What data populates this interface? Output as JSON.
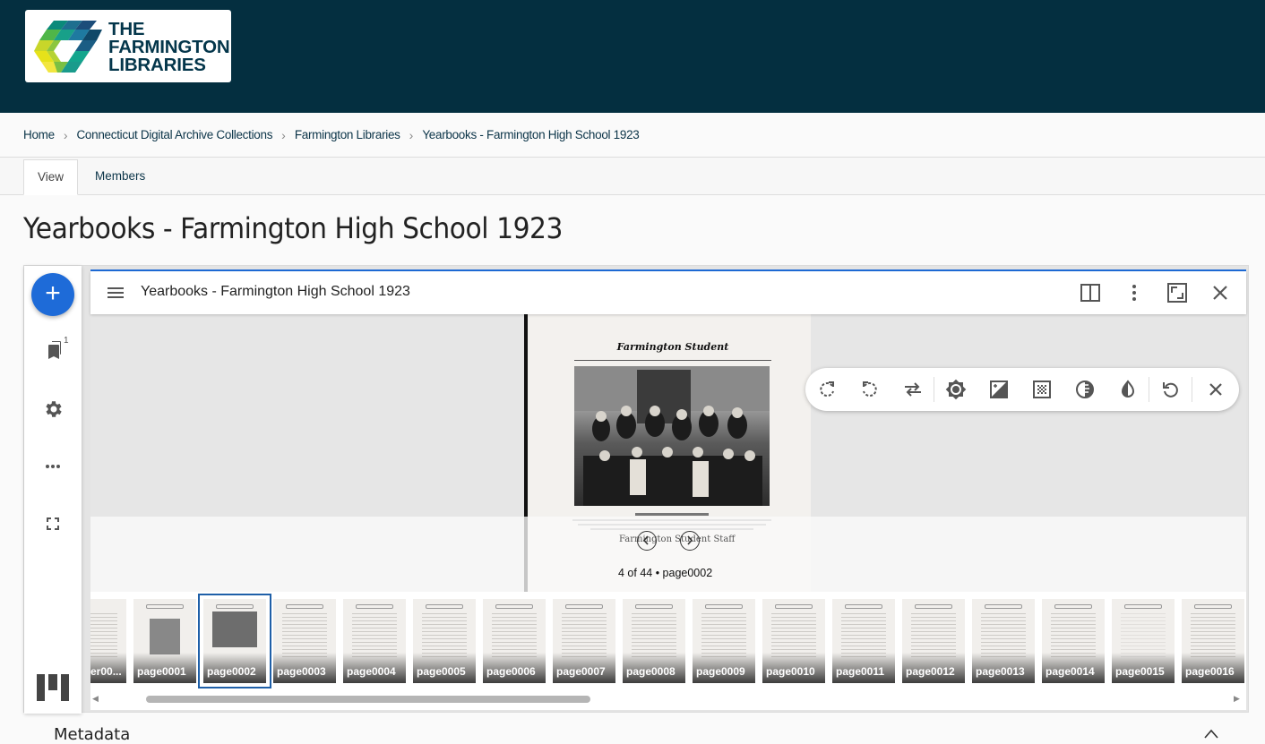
{
  "header": {
    "logo_lines": [
      "THE",
      "FARMINGTON",
      "LIBRARIES"
    ],
    "brand_color": "#042f40"
  },
  "breadcrumb": {
    "items": [
      "Home",
      "Connecticut Digital Archive Collections",
      "Farmington Libraries",
      "Yearbooks - Farmington High School 1923"
    ],
    "separator": "›"
  },
  "tabs": [
    {
      "label": "View",
      "active": true
    },
    {
      "label": "Members",
      "active": false
    }
  ],
  "page_title": "Yearbooks - Farmington High School 1923",
  "viewer": {
    "accent_color": "#1e6bd8",
    "window_title": "Yearbooks - Farmington High School 1923",
    "bookmark_count": "1",
    "rail_icons": [
      "add-icon",
      "bookmark-icon",
      "gear-icon",
      "more-horiz-icon",
      "fullscreen-icon",
      "mirador-logo-icon"
    ],
    "header_icons": [
      "book-view-icon",
      "more-vert-icon",
      "maximize-icon",
      "close-icon"
    ],
    "image_tools": [
      "rotate-right-icon",
      "rotate-left-icon",
      "flip-icon",
      "brightness-icon",
      "contrast-icon",
      "saturation-icon",
      "grayscale-icon",
      "invert-icon",
      "reset-icon",
      "close-icon"
    ],
    "page_heading": "Farmington Student",
    "staff_heading": "Farmington Student Staff",
    "page_status": "4 of 44 • page0002",
    "thumbnails": [
      "er00...",
      "page0001",
      "page0002",
      "page0003",
      "page0004",
      "page0005",
      "page0006",
      "page0007",
      "page0008",
      "page0009",
      "page0010",
      "page0011",
      "page0012",
      "page0013",
      "page0014",
      "page0015",
      "page0016"
    ],
    "selected_thumbnail": "page0002"
  },
  "metadata": {
    "heading": "Metadata"
  }
}
